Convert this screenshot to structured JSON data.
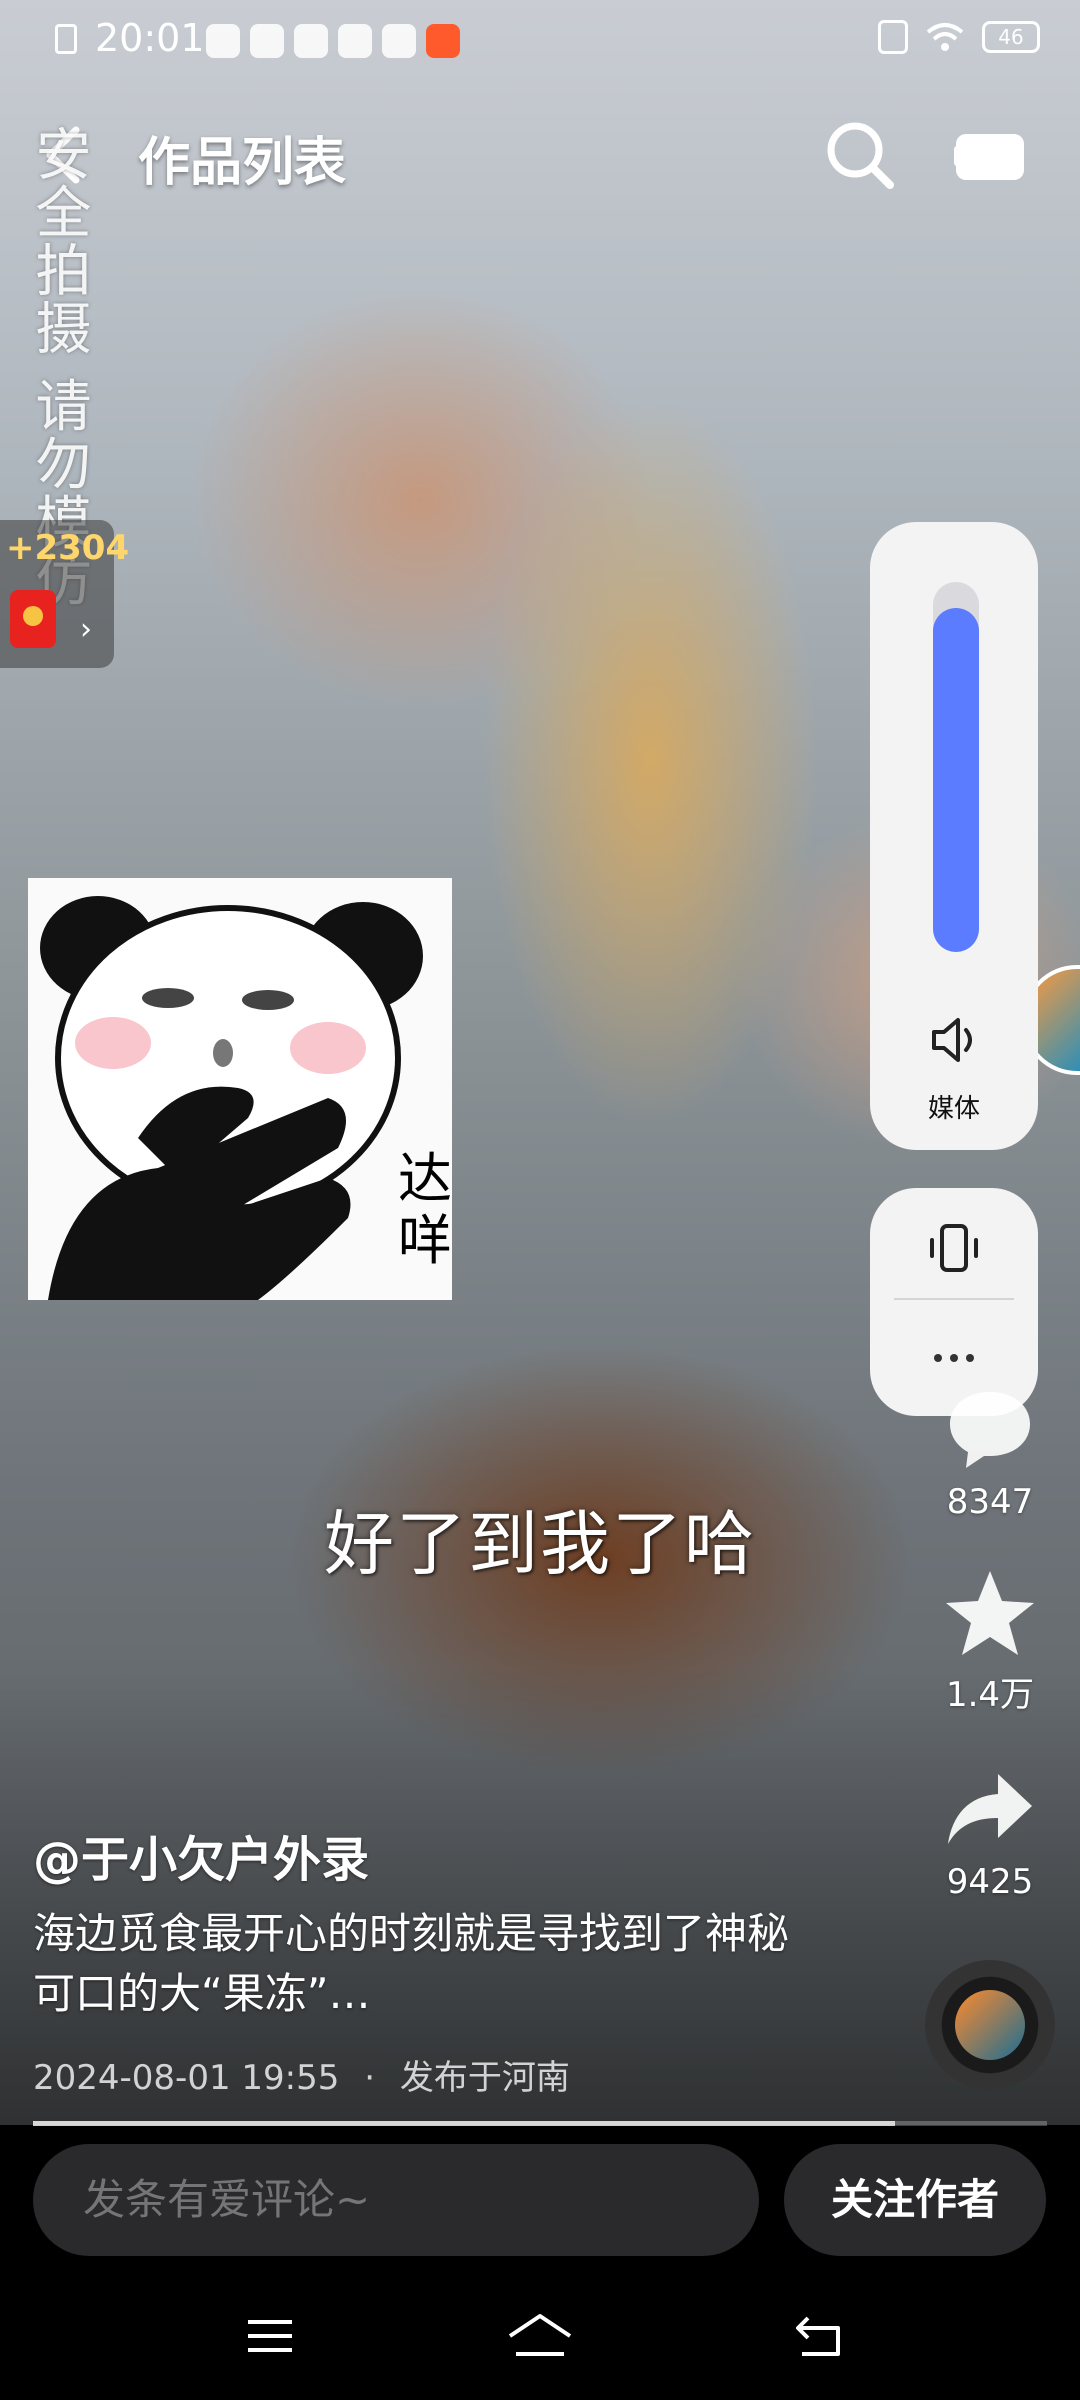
{
  "status_bar": {
    "time": "20:01",
    "battery": "46"
  },
  "nav": {
    "title": "作品列表"
  },
  "watermark": {
    "text": "安全拍摄 请勿模仿"
  },
  "redpacket": {
    "count": "+2304",
    "arrow": "›"
  },
  "sticker": {
    "text": "达咩"
  },
  "volume_panel": {
    "label": "媒体",
    "level_percent": 93
  },
  "actions": {
    "comments": "8347",
    "favorites": "1.4万",
    "shares": "9425"
  },
  "video": {
    "subtitle": "好了到我了哈",
    "progress_percent": 85
  },
  "post": {
    "author": "@于小欠户外录",
    "description": "海边觅食最开心的时刻就是寻找到了神秘可口的大“果冻”…",
    "date": "2024-08-01 19:55",
    "separator": "·",
    "location": "发布于河南"
  },
  "bottom": {
    "comment_placeholder": "发条有爱评论~",
    "follow_label": "关注作者"
  },
  "colors": {
    "volume_fill": "#5b7cff",
    "panel_bg": "#f3f3f4",
    "bottom_bar": "#000000",
    "input_bg": "#2a2a2c"
  }
}
